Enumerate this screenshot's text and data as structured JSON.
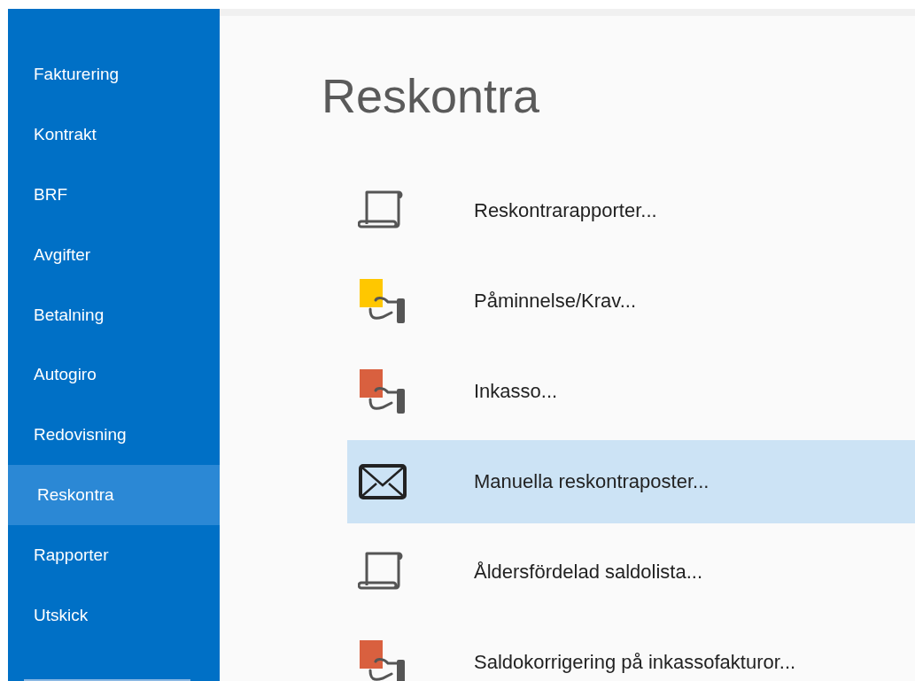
{
  "sidebar": {
    "items": [
      {
        "label": "Fakturering",
        "selected": false
      },
      {
        "label": "Kontrakt",
        "selected": false
      },
      {
        "label": "BRF",
        "selected": false
      },
      {
        "label": "Avgifter",
        "selected": false
      },
      {
        "label": "Betalning",
        "selected": false
      },
      {
        "label": "Autogiro",
        "selected": false
      },
      {
        "label": "Redovisning",
        "selected": false
      },
      {
        "label": "Reskontra",
        "selected": true
      },
      {
        "label": "Rapporter",
        "selected": false
      },
      {
        "label": "Utskick",
        "selected": false
      }
    ]
  },
  "page": {
    "title": "Reskontra",
    "items": [
      {
        "kind": "report",
        "label": "Reskontrarapporter...",
        "selected": false
      },
      {
        "kind": "card",
        "color": "#ffc700",
        "label": "Påminnelse/Krav...",
        "selected": false
      },
      {
        "kind": "card",
        "color": "#d9603f",
        "label": "Inkasso...",
        "selected": false
      },
      {
        "kind": "mail",
        "label": "Manuella reskontraposter...",
        "selected": true
      },
      {
        "kind": "report",
        "label": "Åldersfördelad saldolista...",
        "selected": false
      },
      {
        "kind": "card",
        "color": "#d9603f",
        "label": "Saldokorrigering på inkassofakturor...",
        "selected": false
      }
    ]
  }
}
